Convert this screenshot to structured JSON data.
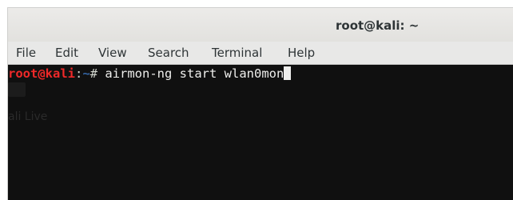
{
  "window": {
    "title": "root@kali: ~"
  },
  "menu": {
    "items": [
      "File",
      "Edit",
      "View",
      "Search",
      "Terminal",
      "Help"
    ]
  },
  "terminal": {
    "prompt_user": "root",
    "prompt_at": "@",
    "prompt_host": "kali",
    "prompt_colon": ":",
    "prompt_path": "~",
    "prompt_symbol": "# ",
    "command": "airmon-ng start wlan0mon",
    "background_text": "ali Live"
  },
  "colors": {
    "terminal_bg": "#101010",
    "prompt_user": "#ef2929",
    "prompt_path": "#3465a4",
    "command_text": "#eeeeec",
    "menubar_bg": "#e8e8e7"
  }
}
